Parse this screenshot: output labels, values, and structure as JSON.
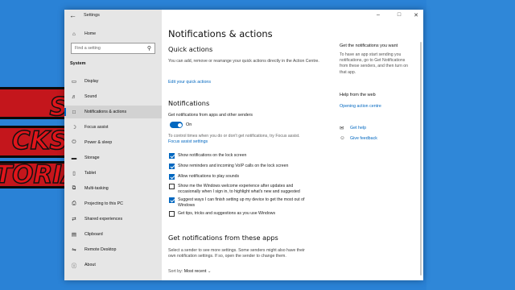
{
  "background": {
    "banner_lines": [
      "S",
      "CKS",
      "TORIALS"
    ],
    "accent_red": "#c4161c",
    "backdrop_blue": "#2a82d6"
  },
  "window": {
    "title": "Settings",
    "back_icon": "back-arrow-icon",
    "controls": [
      "minimize-icon",
      "maximize-icon",
      "close-icon"
    ]
  },
  "sidebar": {
    "home_label": "Home",
    "search_placeholder": "Find a setting",
    "section": "System",
    "items": [
      {
        "label": "Display",
        "icon": "display-icon"
      },
      {
        "label": "Sound",
        "icon": "sound-icon"
      },
      {
        "label": "Notifications & actions",
        "icon": "notifications-icon",
        "active": true
      },
      {
        "label": "Focus assist",
        "icon": "moon-icon"
      },
      {
        "label": "Power & sleep",
        "icon": "power-icon"
      },
      {
        "label": "Storage",
        "icon": "storage-icon"
      },
      {
        "label": "Tablet",
        "icon": "tablet-icon"
      },
      {
        "label": "Multi-tasking",
        "icon": "multitasking-icon"
      },
      {
        "label": "Projecting to this PC",
        "icon": "projecting-icon"
      },
      {
        "label": "Shared experiences",
        "icon": "shared-icon"
      },
      {
        "label": "Clipboard",
        "icon": "clipboard-icon"
      },
      {
        "label": "Remote Desktop",
        "icon": "remote-desktop-icon"
      },
      {
        "label": "About",
        "icon": "info-icon"
      }
    ]
  },
  "main": {
    "title": "Notifications & actions",
    "quick_actions": {
      "heading": "Quick actions",
      "description": "You can add, remove or rearrange your quick actions directly in the Action Centre.",
      "link": "Edit your quick actions"
    },
    "notifications": {
      "heading": "Notifications",
      "toggle_caption": "Get notifications from apps and other senders",
      "toggle_state": "On",
      "hint": "To control times when you do or don't get notifications, try Focus assist.",
      "focus_link": "Focus assist settings",
      "checkboxes": [
        {
          "label": "Show notifications on the lock screen",
          "checked": true
        },
        {
          "label": "Show reminders and incoming VoIP calls on the lock screen",
          "checked": true
        },
        {
          "label": "Allow notifications to play sounds",
          "checked": true
        },
        {
          "label": "Show me the Windows welcome experience after updates and occasionally when I sign in, to highlight what's new and suggested",
          "checked": false
        },
        {
          "label": "Suggest ways I can finish setting up my device to get the most out of Windows",
          "checked": true
        },
        {
          "label": "Get tips, tricks and suggestions as you use Windows",
          "checked": false
        }
      ]
    },
    "senders": {
      "heading": "Get notifications from these apps",
      "description": "Select a sender to see more settings. Some senders might also have their own notification settings. If so, open the sender to change them.",
      "sort_label": "Sort by:",
      "sort_value": "Most recent"
    }
  },
  "right_panel": {
    "get_title": "Get the notifications you want",
    "get_text": "To have an app start sending you notifications, go to Get Notifications from these senders, and then turn on that app.",
    "help_title": "Help from the web",
    "help_link": "Opening action centre",
    "get_help": "Get help",
    "give_feedback": "Give feedback"
  },
  "colors": {
    "accent": "#0067c0",
    "sidebar_bg": "#e6e6e6"
  }
}
